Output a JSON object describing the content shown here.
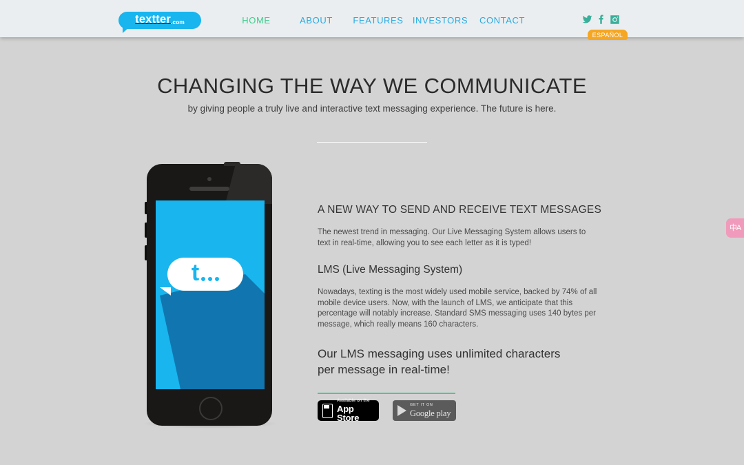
{
  "header": {
    "logo": {
      "name": "textter",
      "tld": ".com",
      "icon": "speech-bubble-logo",
      "color": "#18b5ef"
    },
    "nav": [
      {
        "label": "HOME",
        "active": true
      },
      {
        "label": "ABOUT",
        "active": false
      },
      {
        "label": "FEATURES",
        "active": false
      },
      {
        "label": "INVESTORS",
        "active": false
      },
      {
        "label": "CONTACT",
        "active": false
      }
    ],
    "nav_active_color": "#3ecf8e",
    "nav_color": "#29abe2",
    "social": [
      {
        "icon": "twitter-icon",
        "label": "Twitter"
      },
      {
        "icon": "facebook-icon",
        "label": "Facebook"
      },
      {
        "icon": "instagram-icon",
        "label": "Instagram"
      }
    ],
    "social_color": "#3aaf9a",
    "language_badge": {
      "label": "ESPAÑOL",
      "color": "#f5a623"
    },
    "background": "#eaeef0"
  },
  "hero": {
    "title": "CHANGING THE WAY WE COMMUNICATE",
    "subtitle": "by giving people a truly live and interactive text messaging experience. The future is here."
  },
  "phone": {
    "screen_color": "#18b5ef",
    "bubble_glyph": "t",
    "bubble_dots": 3,
    "icon": "phone-mockup"
  },
  "content": {
    "heading": "A NEW WAY TO SEND AND RECEIVE TEXT MESSAGES",
    "paragraph1": "The newest trend in messaging. Our Live Messaging System allows users  to text in real-time, allowing you to see each letter as it is typed!",
    "subheading": "LMS (Live Messaging System)",
    "paragraph2": "Nowadays, texting is the most widely used mobile service, backed by 74% of all mobile device users. Now, with the launch of LMS, we anticipate that this percentage will notably increase. Standard SMS messaging uses 140 bytes per message, which really means 160 characters.",
    "callout_line1": "Our LMS messaging uses unlimited characters",
    "callout_line2": "per message in real-time!",
    "divider_color": "#3ecf8e"
  },
  "stores": {
    "apple": {
      "small": "Available on the",
      "big": "App Store",
      "icon": "apple-phone-icon"
    },
    "google": {
      "small": "GET IT ON",
      "big": "Google play",
      "icon": "google-play-triangle-icon"
    }
  },
  "widgets": {
    "translate": {
      "icon": "translate-icon",
      "glyph": "中A",
      "color": "#f09bbb"
    }
  },
  "page": {
    "background": "#d3d3d3"
  }
}
